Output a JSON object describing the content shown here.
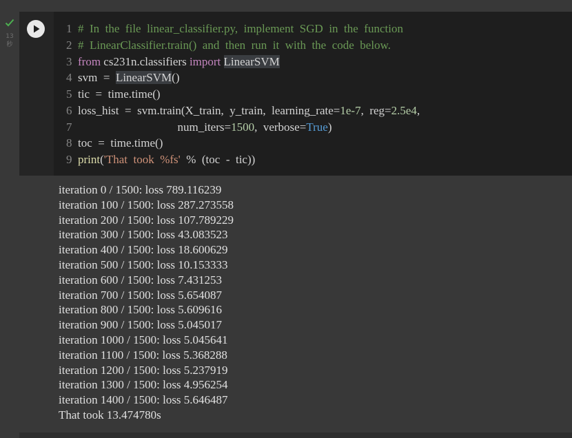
{
  "gutter": {
    "status_icon": "check-icon",
    "status_color": "#4caf50",
    "exec_time_value": "13",
    "exec_time_unit": "秒"
  },
  "run_button": {
    "icon": "play-icon"
  },
  "code": {
    "line_numbers": [
      "1",
      "2",
      "3",
      "4",
      "5",
      "6",
      "7",
      "8",
      "9"
    ],
    "line1": "#  In  the  file  linear_classifier.py,  implement  SGD  in  the  function",
    "line2": "#  LinearClassifier.train()  and  then  run  it  with  the  code  below.",
    "line3": {
      "from": "from",
      "module": " cs231n.classifiers ",
      "import": "import",
      "name": "LinearSVM"
    },
    "line4": {
      "var": "svm  =  ",
      "call": "LinearSVM",
      "rest": "()"
    },
    "line5": {
      "var": "tic  =  time.",
      "fn": "time",
      "rest": "()"
    },
    "line6": {
      "var": "loss_hist  =  svm.",
      "fn": "train",
      "args": "(X_train,  y_train,  learning_rate=",
      "lr": "1e-7",
      "mid": ",  reg=",
      "reg": "2.5e4",
      "end": ","
    },
    "line7": {
      "pad": "                                  num_iters=",
      "iters": "1500",
      "mid": ",  verbose=",
      "verbose": "True",
      "end": ")"
    },
    "line8": {
      "var": "toc  =  time.",
      "fn": "time",
      "rest": "()"
    },
    "line9": {
      "fn": "print",
      "open": "(",
      "str": "'That  took  %fs'",
      "rest": "  %  (toc  -  tic))"
    }
  },
  "output": [
    "iteration 0 / 1500: loss 789.116239",
    "iteration 100 / 1500: loss 287.273558",
    "iteration 200 / 1500: loss 107.789229",
    "iteration 300 / 1500: loss 43.083523",
    "iteration 400 / 1500: loss 18.600629",
    "iteration 500 / 1500: loss 10.153333",
    "iteration 600 / 1500: loss 7.431253",
    "iteration 700 / 1500: loss 5.654087",
    "iteration 800 / 1500: loss 5.609616",
    "iteration 900 / 1500: loss 5.045017",
    "iteration 1000 / 1500: loss 5.045641",
    "iteration 1100 / 1500: loss 5.368288",
    "iteration 1200 / 1500: loss 5.237919",
    "iteration 1300 / 1500: loss 4.956254",
    "iteration 1400 / 1500: loss 5.646487",
    "That took 13.474780s"
  ]
}
